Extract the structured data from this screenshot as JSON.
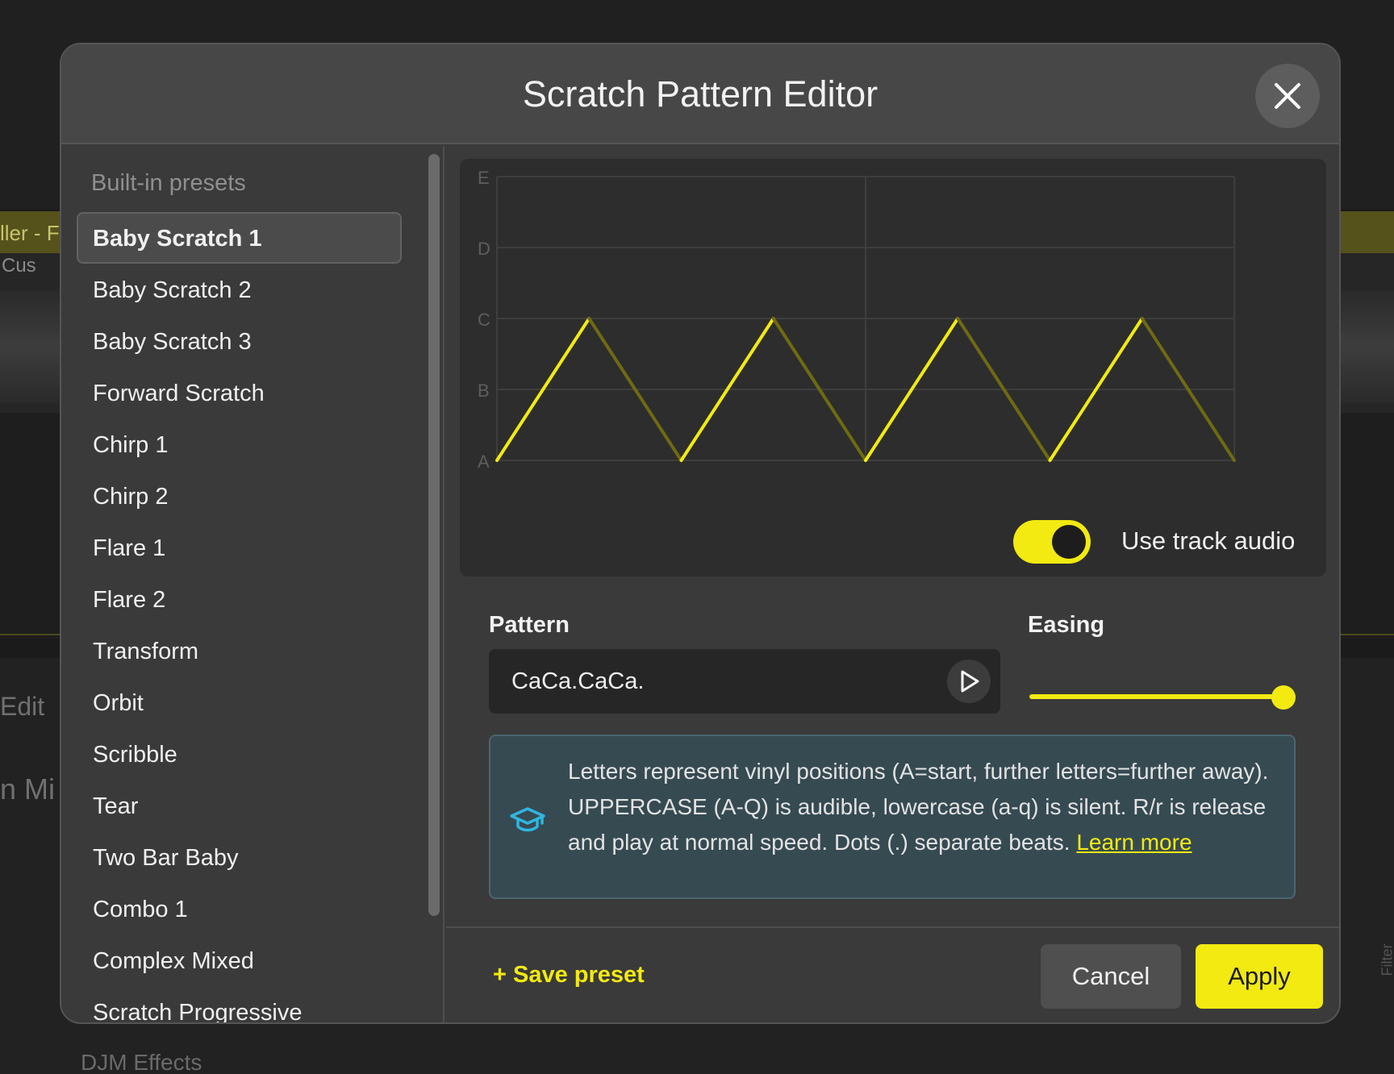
{
  "background": {
    "deck_label": "ller - F",
    "deck_sublabel": "Cus",
    "edit_label": "Edit",
    "mix_label": "n Mi",
    "effects_label": "DJM Effects",
    "filter_label": "Filter"
  },
  "dialog": {
    "title": "Scratch Pattern Editor",
    "close_icon": "close-icon"
  },
  "sidebar": {
    "heading": "Built-in presets",
    "items": [
      {
        "label": "Baby Scratch 1",
        "selected": true
      },
      {
        "label": "Baby Scratch 2"
      },
      {
        "label": "Baby Scratch 3"
      },
      {
        "label": "Forward Scratch"
      },
      {
        "label": "Chirp 1"
      },
      {
        "label": "Chirp 2"
      },
      {
        "label": "Flare 1"
      },
      {
        "label": "Flare 2"
      },
      {
        "label": "Transform"
      },
      {
        "label": "Orbit"
      },
      {
        "label": "Scribble"
      },
      {
        "label": "Tear"
      },
      {
        "label": "Two Bar Baby"
      },
      {
        "label": "Combo 1"
      },
      {
        "label": "Complex Mixed"
      },
      {
        "label": "Scratch Progressive"
      }
    ]
  },
  "graph": {
    "y_labels": [
      "E",
      "D",
      "C",
      "B",
      "A"
    ],
    "pattern_points": [
      {
        "beat": 0,
        "pos": "A"
      },
      {
        "beat": 0.5,
        "pos": "C"
      },
      {
        "beat": 1,
        "pos": "A"
      },
      {
        "beat": 1.5,
        "pos": "C"
      },
      {
        "beat": 2,
        "pos": "A"
      },
      {
        "beat": 2.5,
        "pos": "C"
      },
      {
        "beat": 3,
        "pos": "A"
      },
      {
        "beat": 3.5,
        "pos": "C"
      },
      {
        "beat": 4,
        "pos": "A"
      }
    ],
    "colors": {
      "audible": "#f2ea10",
      "release": "#6f6a12",
      "grid": "#3e3e3e"
    }
  },
  "toggle": {
    "label": "Use track audio",
    "on": true
  },
  "pattern": {
    "label": "Pattern",
    "value": "CaCa.CaCa.",
    "play_icon": "play-icon"
  },
  "easing": {
    "label": "Easing",
    "value": 1.0
  },
  "info": {
    "icon": "graduation-cap-icon",
    "text": "Letters represent vinyl positions (A=start, further letters=further away). UPPERCASE (A-Q) is audible, lowercase (a-q) is silent. R/r is release and play at normal speed. Dots (.) separate beats.",
    "link": "Learn more"
  },
  "footer": {
    "save_preset": "+ Save preset",
    "cancel": "Cancel",
    "apply": "Apply"
  },
  "accent_color": "#f2ea10"
}
